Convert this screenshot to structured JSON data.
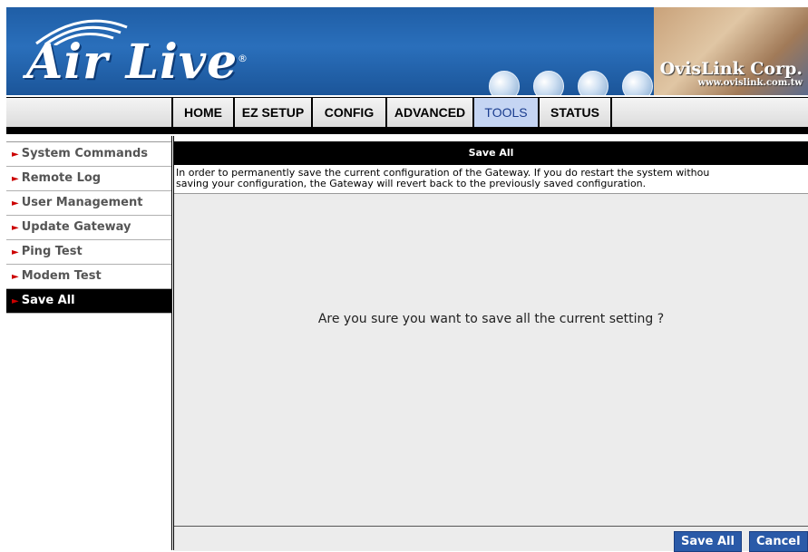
{
  "brand": {
    "logo": "Air Live",
    "logo_mark": "®",
    "company": "OvisLink Corp.",
    "company_url": "www.ovislink.com.tw"
  },
  "nav": {
    "tabs": [
      {
        "label": "HOME"
      },
      {
        "label": "EZ SETUP"
      },
      {
        "label": "CONFIG"
      },
      {
        "label": "ADVANCED"
      },
      {
        "label": "TOOLS",
        "active": true
      },
      {
        "label": "STATUS"
      }
    ]
  },
  "sidebar": {
    "items": [
      {
        "label": "System Commands"
      },
      {
        "label": "Remote Log"
      },
      {
        "label": "User Management"
      },
      {
        "label": "Update Gateway"
      },
      {
        "label": "Ping Test"
      },
      {
        "label": "Modem Test"
      },
      {
        "label": "Save All",
        "active": true
      }
    ],
    "bullet": "►"
  },
  "main": {
    "title": "Save All",
    "description_line1": "In order to permanently save the current configuration of the Gateway. If you do restart the system withou",
    "description_line2": "saving your configuration, the Gateway will revert back to the previously saved configuration.",
    "confirm_text": "Are you sure you want to save all the current setting ?",
    "save_button": "Save All",
    "cancel_button": "Cancel"
  },
  "colors": {
    "banner_blue": "#1f5ea6",
    "active_tab": "#c5d5f3",
    "button_blue": "#2a5aa8",
    "sidebar_bullet": "#cc0000"
  }
}
